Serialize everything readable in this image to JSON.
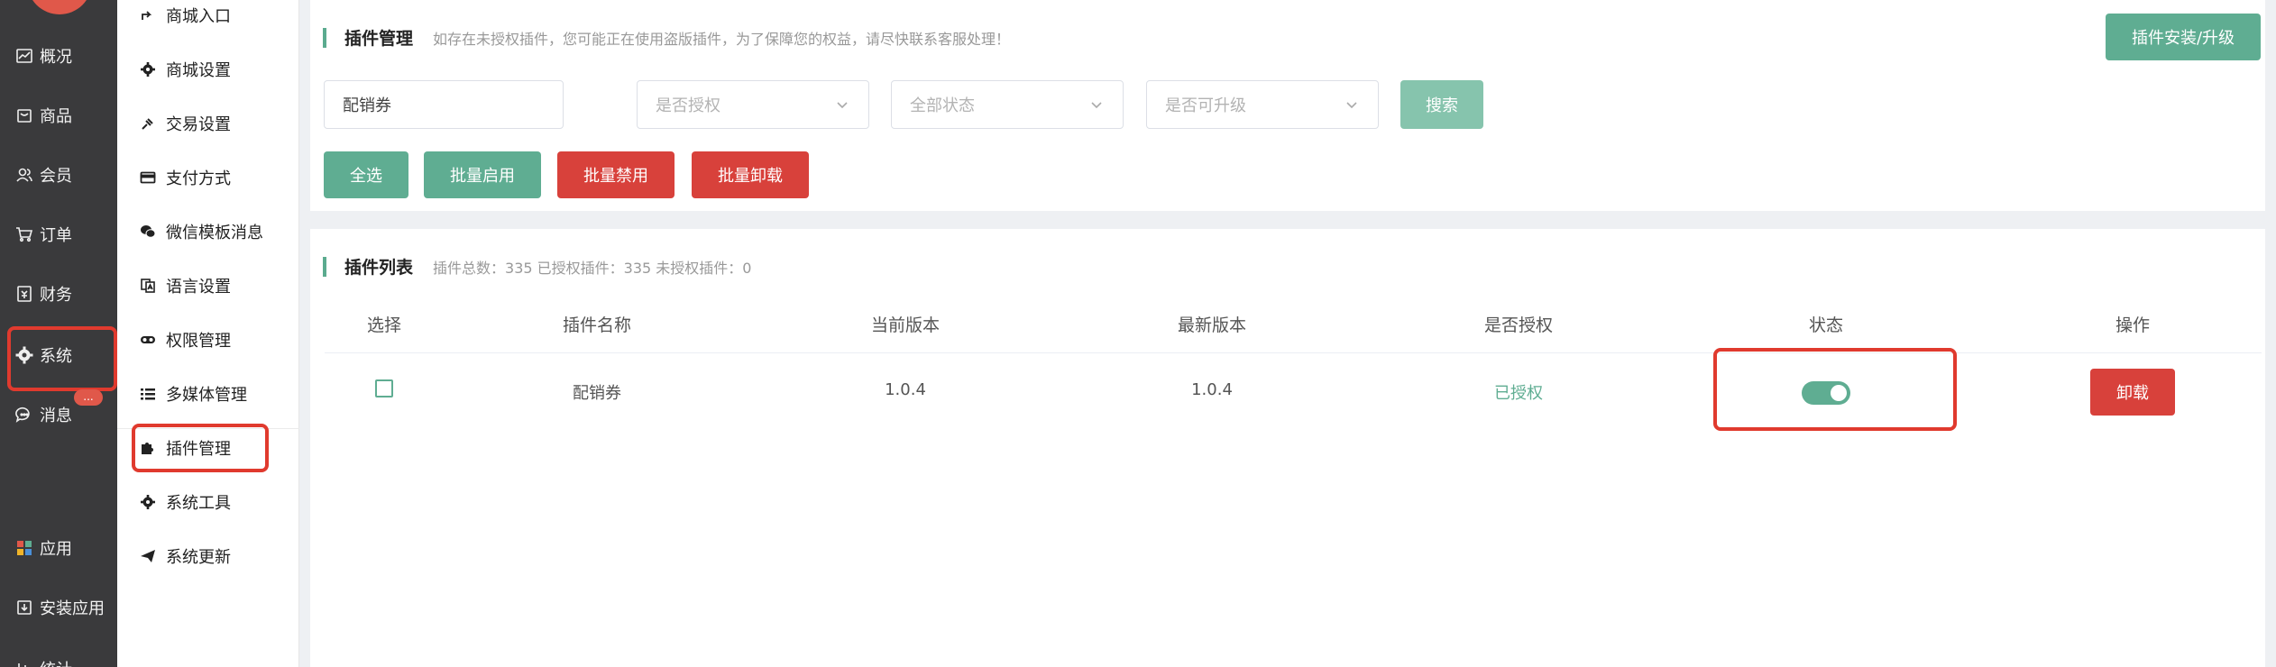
{
  "sidebar": {
    "items": [
      {
        "label": "概况",
        "icon": "chart-line-icon"
      },
      {
        "label": "商品",
        "icon": "shop-bag-icon"
      },
      {
        "label": "会员",
        "icon": "users-icon"
      },
      {
        "label": "订单",
        "icon": "cart-icon"
      },
      {
        "label": "财务",
        "icon": "finance-icon"
      },
      {
        "label": "系统",
        "icon": "gear-icon"
      },
      {
        "label": "消息",
        "icon": "chat-icon"
      },
      {
        "label": "应用",
        "icon": "apps-grid-icon"
      },
      {
        "label": "安装应用",
        "icon": "install-icon"
      },
      {
        "label": "统计",
        "icon": "stats-icon"
      }
    ],
    "badge": "..."
  },
  "submenu": {
    "items": [
      {
        "label": "商城入口",
        "icon": "share-icon"
      },
      {
        "label": "商城设置",
        "icon": "gear-icon"
      },
      {
        "label": "交易设置",
        "icon": "pin-icon"
      },
      {
        "label": "支付方式",
        "icon": "credit-card-icon"
      },
      {
        "label": "微信模板消息",
        "icon": "wechat-icon"
      },
      {
        "label": "语言设置",
        "icon": "language-icon"
      },
      {
        "label": "权限管理",
        "icon": "key-icon"
      },
      {
        "label": "多媒体管理",
        "icon": "list-icon"
      },
      {
        "label": "插件管理",
        "icon": "puzzle-icon"
      },
      {
        "label": "系统工具",
        "icon": "gear-icon"
      },
      {
        "label": "系统更新",
        "icon": "send-icon"
      }
    ]
  },
  "header": {
    "title": "插件管理",
    "notice": "如存在未授权插件，您可能正在使用盗版插件，为了保障您的权益，请尽快联系客服处理！",
    "install_button": "插件安装/升级"
  },
  "filters": {
    "keyword_value": "配销券",
    "authorized_placeholder": "是否授权",
    "status_placeholder": "全部状态",
    "upgradable_placeholder": "是否可升级",
    "search_button": "搜索"
  },
  "actions": {
    "select_all": "全选",
    "batch_enable": "批量启用",
    "batch_disable": "批量禁用",
    "batch_uninstall": "批量卸载"
  },
  "list": {
    "title": "插件列表",
    "summary": "插件总数：335 已授权插件：335 未授权插件：0",
    "columns": [
      "选择",
      "插件名称",
      "当前版本",
      "最新版本",
      "是否授权",
      "状态",
      "操作"
    ],
    "rows": [
      {
        "name": "配销券",
        "current_version": "1.0.4",
        "latest_version": "1.0.4",
        "authorized": "已授权",
        "enabled": true,
        "action": "卸载"
      }
    ]
  },
  "colors": {
    "accent": "#5fad92",
    "danger": "#d8413b",
    "highlight": "#e03a2e",
    "sidebar_bg": "#3a3a3c"
  }
}
